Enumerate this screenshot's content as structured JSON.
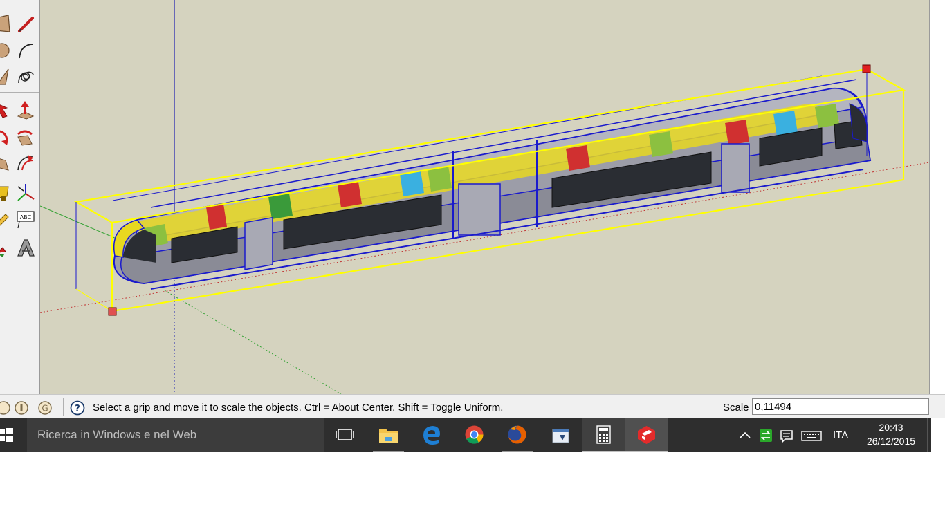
{
  "status_bar": {
    "hint": "Select a grip and move it to scale the objects. Ctrl = About Center. Shift = Toggle Uniform.",
    "measure_label": "Scale",
    "measure_value": "0,11494"
  },
  "taskbar": {
    "search_placeholder": "Ricerca in Windows e nel Web",
    "language": "ITA",
    "time": "20:43",
    "date": "26/12/2015",
    "apps": [
      "task-view-icon",
      "file-explorer-icon",
      "edge-icon",
      "chrome-icon",
      "firefox-icon",
      "notepad-icon",
      "calculator-icon",
      "sketchup-icon"
    ]
  },
  "toolbar": {
    "tools": [
      "rectangle-tool-icon",
      "pencil-tool-icon",
      "circle-tool-icon",
      "arc-tool-icon",
      "polygon-tool-icon",
      "freehand-tool-icon",
      "move-tool-icon",
      "push-pull-tool-icon",
      "rotate-tool-icon",
      "follow-me-tool-icon",
      "tape-measure-tool-icon",
      "offset-tool-icon",
      "paint-bucket-tool-icon",
      "axes-tool-icon",
      "eraser-tool-icon",
      "text-tool-icon",
      "orbit-tool-icon",
      "3d-text-tool-icon"
    ],
    "text_tool_label": "ABC"
  },
  "colors": {
    "viewport_bg": "#d5d3bf",
    "selection_blue": "#1a1acc",
    "bounding_box_yellow": "#ffff00",
    "grip_red": "#e02020",
    "taskbar_bg": "#2e2e2e"
  }
}
